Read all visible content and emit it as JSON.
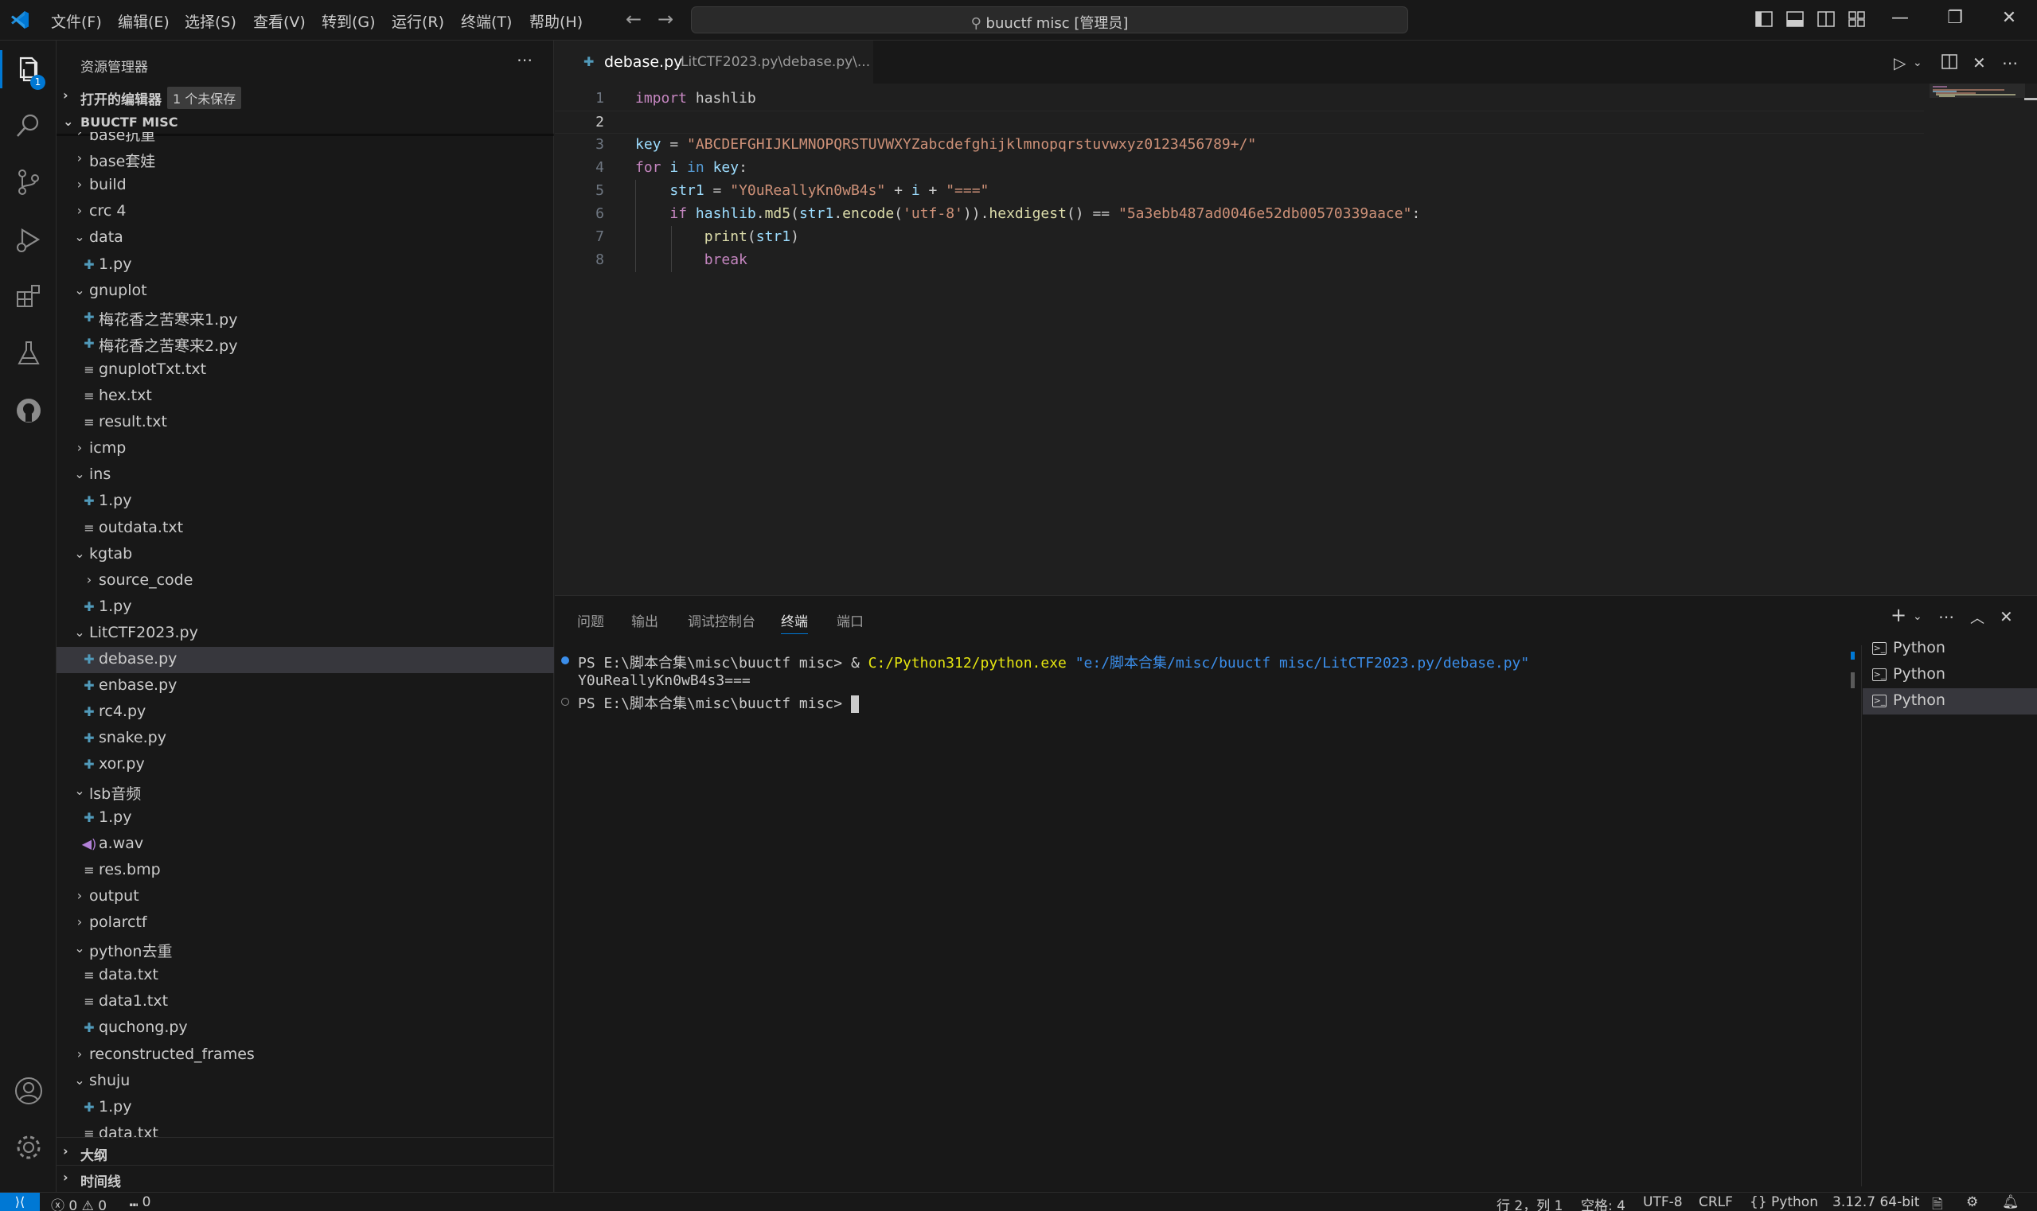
{
  "titlebar": {
    "menus": [
      "文件(F)",
      "编辑(E)",
      "选择(S)",
      "查看(V)",
      "转到(G)",
      "运行(R)",
      "终端(T)",
      "帮助(H)"
    ],
    "search_text": "buuctf misc [管理员]"
  },
  "activity": {
    "explorer_badge": "1"
  },
  "sidebar": {
    "title": "资源管理器",
    "open_editors_label": "打开的编辑器",
    "unsaved_badge": "1 个未保存",
    "folder_label": "BUUCTF MISC",
    "outline_label": "大纲",
    "timeline_label": "时间线",
    "tree": [
      {
        "name": "base抗重",
        "type": "folder",
        "open": false,
        "depth": 0
      },
      {
        "name": "base套娃",
        "type": "folder",
        "open": false,
        "depth": 0
      },
      {
        "name": "build",
        "type": "folder",
        "open": false,
        "depth": 0
      },
      {
        "name": "crc 4",
        "type": "folder",
        "open": false,
        "depth": 0
      },
      {
        "name": "data",
        "type": "folder",
        "open": true,
        "depth": 0
      },
      {
        "name": "1.py",
        "type": "py",
        "depth": 1
      },
      {
        "name": "gnuplot",
        "type": "folder",
        "open": true,
        "depth": 0
      },
      {
        "name": "梅花香之苦寒来1.py",
        "type": "py",
        "depth": 1
      },
      {
        "name": "梅花香之苦寒来2.py",
        "type": "py",
        "depth": 1
      },
      {
        "name": "gnuplotTxt.txt",
        "type": "txt",
        "depth": 1
      },
      {
        "name": "hex.txt",
        "type": "txt",
        "depth": 1
      },
      {
        "name": "result.txt",
        "type": "txt",
        "depth": 1
      },
      {
        "name": "icmp",
        "type": "folder",
        "open": false,
        "depth": 0
      },
      {
        "name": "ins",
        "type": "folder",
        "open": true,
        "depth": 0
      },
      {
        "name": "1.py",
        "type": "py",
        "depth": 1
      },
      {
        "name": "outdata.txt",
        "type": "txt",
        "depth": 1
      },
      {
        "name": "kgtab",
        "type": "folder",
        "open": true,
        "depth": 0
      },
      {
        "name": "source_code",
        "type": "folder",
        "open": false,
        "depth": 1
      },
      {
        "name": "1.py",
        "type": "py",
        "depth": 1
      },
      {
        "name": "LitCTF2023.py",
        "type": "folder",
        "open": true,
        "depth": 0
      },
      {
        "name": "debase.py",
        "type": "py",
        "depth": 1,
        "selected": true
      },
      {
        "name": "enbase.py",
        "type": "py",
        "depth": 1
      },
      {
        "name": "rc4.py",
        "type": "py",
        "depth": 1
      },
      {
        "name": "snake.py",
        "type": "py",
        "depth": 1
      },
      {
        "name": "xor.py",
        "type": "py",
        "depth": 1
      },
      {
        "name": "lsb音频",
        "type": "folder",
        "open": true,
        "depth": 0
      },
      {
        "name": "1.py",
        "type": "py",
        "depth": 1
      },
      {
        "name": "a.wav",
        "type": "wav",
        "depth": 1
      },
      {
        "name": "res.bmp",
        "type": "txt",
        "depth": 1
      },
      {
        "name": "output",
        "type": "folder",
        "open": false,
        "depth": 0
      },
      {
        "name": "polarctf",
        "type": "folder",
        "open": false,
        "depth": 0
      },
      {
        "name": "python去重",
        "type": "folder",
        "open": true,
        "depth": 0
      },
      {
        "name": "data.txt",
        "type": "txt",
        "depth": 1
      },
      {
        "name": "data1.txt",
        "type": "txt",
        "depth": 1
      },
      {
        "name": "quchong.py",
        "type": "py",
        "depth": 1
      },
      {
        "name": "reconstructed_frames",
        "type": "folder",
        "open": false,
        "depth": 0
      },
      {
        "name": "shuju",
        "type": "folder",
        "open": true,
        "depth": 0
      },
      {
        "name": "1.py",
        "type": "py",
        "depth": 1
      },
      {
        "name": "data.txt",
        "type": "txt",
        "depth": 1
      }
    ]
  },
  "editor": {
    "tab_name": "debase.py",
    "tab_path": "LitCTF2023.py\\debase.py\\...",
    "active_line": 2,
    "lines": [
      [
        {
          "t": "kw",
          "v": "import"
        },
        {
          "t": "plain",
          "v": " hashlib"
        }
      ],
      [],
      [
        {
          "t": "var",
          "v": "key"
        },
        {
          "t": "plain",
          "v": " = "
        },
        {
          "t": "str",
          "v": "\"ABCDEFGHIJKLMNOPQRSTUVWXYZabcdefghijklmnopqrstuvwxyz0123456789+/\""
        }
      ],
      [
        {
          "t": "kw",
          "v": "for"
        },
        {
          "t": "plain",
          "v": " "
        },
        {
          "t": "var",
          "v": "i"
        },
        {
          "t": "plain",
          "v": " "
        },
        {
          "t": "kwb",
          "v": "in"
        },
        {
          "t": "plain",
          "v": " "
        },
        {
          "t": "var",
          "v": "key"
        },
        {
          "t": "plain",
          "v": ":"
        }
      ],
      [
        {
          "t": "plain",
          "v": "    "
        },
        {
          "t": "var",
          "v": "str1"
        },
        {
          "t": "plain",
          "v": " = "
        },
        {
          "t": "str",
          "v": "\"Y0uReallyKn0wB4s\""
        },
        {
          "t": "plain",
          "v": " + "
        },
        {
          "t": "var",
          "v": "i"
        },
        {
          "t": "plain",
          "v": " + "
        },
        {
          "t": "str",
          "v": "\"===\""
        }
      ],
      [
        {
          "t": "plain",
          "v": "    "
        },
        {
          "t": "kw",
          "v": "if"
        },
        {
          "t": "plain",
          "v": " "
        },
        {
          "t": "var",
          "v": "hashlib"
        },
        {
          "t": "plain",
          "v": "."
        },
        {
          "t": "fn",
          "v": "md5"
        },
        {
          "t": "plain",
          "v": "("
        },
        {
          "t": "var",
          "v": "str1"
        },
        {
          "t": "plain",
          "v": "."
        },
        {
          "t": "fn",
          "v": "encode"
        },
        {
          "t": "plain",
          "v": "("
        },
        {
          "t": "str",
          "v": "'utf-8'"
        },
        {
          "t": "plain",
          "v": "))."
        },
        {
          "t": "fn",
          "v": "hexdigest"
        },
        {
          "t": "plain",
          "v": "() == "
        },
        {
          "t": "str",
          "v": "\"5a3ebb487ad0046e52db00570339aace\""
        },
        {
          "t": "plain",
          "v": ":"
        }
      ],
      [
        {
          "t": "plain",
          "v": "        "
        },
        {
          "t": "fn",
          "v": "print"
        },
        {
          "t": "plain",
          "v": "("
        },
        {
          "t": "var",
          "v": "str1"
        },
        {
          "t": "plain",
          "v": ")"
        }
      ],
      [
        {
          "t": "plain",
          "v": "        "
        },
        {
          "t": "kw",
          "v": "break"
        }
      ]
    ]
  },
  "panel": {
    "tabs": [
      "问题",
      "输出",
      "调试控制台",
      "终端",
      "端口"
    ],
    "active_tab": 3,
    "terminal": {
      "line1_prompt": "PS E:\\脚本合集\\misc\\buuctf misc> ",
      "line1_amp": "& ",
      "line1_exe": "C:/Python312/python.exe",
      "line1_arg": " \"e:/脚本合集/misc/buuctf misc/LitCTF2023.py/debase.py\"",
      "line2": "Y0uReallyKn0wB4s3===",
      "line3_prompt": "PS E:\\脚本合集\\misc\\buuctf misc> "
    },
    "terminals": [
      {
        "label": "Python",
        "selected": false
      },
      {
        "label": "Python",
        "selected": false
      },
      {
        "label": "Python",
        "selected": true
      }
    ]
  },
  "statusbar": {
    "errors": "0",
    "warnings": "0",
    "ports": "0",
    "position": "行 2，列 1",
    "spaces": "空格: 4",
    "encoding": "UTF-8",
    "eol": "CRLF",
    "language": "Python",
    "interpreter": "3.12.7 64-bit"
  },
  "colors": {
    "accent": "#0078d4",
    "background": "#1f1f1f",
    "sidebar": "#181818"
  }
}
